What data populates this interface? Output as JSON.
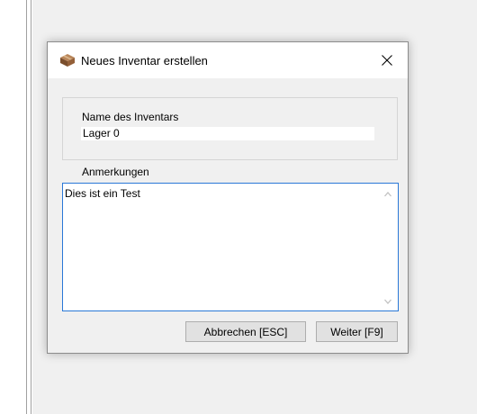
{
  "dialog": {
    "title": "Neues Inventar erstellen",
    "icon": "box-icon",
    "close_symbol": "close-icon"
  },
  "inventory_name": {
    "label": "Name des Inventars",
    "value": "Lager 0"
  },
  "notes": {
    "label": "Anmerkungen",
    "value": "Dies ist ein Test"
  },
  "buttons": {
    "cancel_label": "Abbrechen [ESC]",
    "next_label": "Weiter [F9]"
  },
  "colors": {
    "focus_border": "#2a78d7",
    "dialog_bg": "#f0f0f0",
    "button_bg": "#e1e1e1"
  }
}
